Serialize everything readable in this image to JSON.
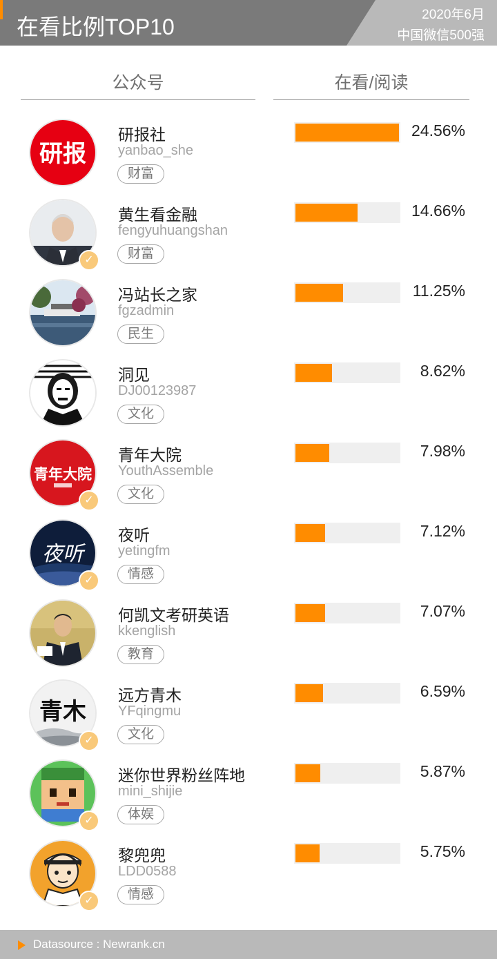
{
  "header": {
    "title": "在看比例TOP10",
    "date": "2020年6月",
    "subtitle": "中国微信500强"
  },
  "columns": {
    "account": "公众号",
    "ratio": "在看/阅读"
  },
  "colors": {
    "accent": "#ff8c00",
    "track": "#efefef",
    "header_bg": "#7a7a7a",
    "ribbon_bg": "#b9b9b9"
  },
  "chart_data": {
    "type": "bar",
    "orientation": "horizontal",
    "value_label": "在看/阅读",
    "unit": "%",
    "categories": [
      "研报社",
      "黄生看金融",
      "冯站长之家",
      "洞见",
      "青年大院",
      "夜听",
      "何凯文考研英语",
      "远方青木",
      "迷你世界粉丝阵地",
      "黎兜兜"
    ],
    "values": [
      24.56,
      14.66,
      11.25,
      8.62,
      7.98,
      7.12,
      7.07,
      6.59,
      5.87,
      5.75
    ],
    "xlim": [
      0,
      24.56
    ],
    "grid": false,
    "legend": "none"
  },
  "rows": [
    {
      "name": "研报社",
      "account": "yanbao_she",
      "tag": "财富",
      "value": 24.56,
      "pct_label": "24.56%",
      "verified": false,
      "avatar_icon": "yanbao-logo-icon",
      "avatar_text": "研报"
    },
    {
      "name": "黄生看金融",
      "account": "fengyuhuangshan",
      "tag": "财富",
      "value": 14.66,
      "pct_label": "14.66%",
      "verified": true,
      "avatar_icon": "man-portrait-icon"
    },
    {
      "name": "冯站长之家",
      "account": "fgzadmin",
      "tag": "民生",
      "value": 11.25,
      "pct_label": "11.25%",
      "verified": false,
      "avatar_icon": "lake-scenery-icon"
    },
    {
      "name": "洞见",
      "account": "DJ00123987",
      "tag": "文化",
      "value": 8.62,
      "pct_label": "8.62%",
      "verified": false,
      "avatar_icon": "woodcut-portrait-icon"
    },
    {
      "name": "青年大院",
      "account": "YouthAssemble",
      "tag": "文化",
      "value": 7.98,
      "pct_label": "7.98%",
      "verified": true,
      "avatar_icon": "youth-logo-icon",
      "avatar_text": "青年大院"
    },
    {
      "name": "夜听",
      "account": "yetingfm",
      "tag": "情感",
      "value": 7.12,
      "pct_label": "7.12%",
      "verified": true,
      "avatar_icon": "night-logo-icon",
      "avatar_text": "夜听"
    },
    {
      "name": "何凯文考研英语",
      "account": "kkenglish",
      "tag": "教育",
      "value": 7.07,
      "pct_label": "7.07%",
      "verified": false,
      "avatar_icon": "speaker-photo-icon"
    },
    {
      "name": "远方青木",
      "account": "YFqingmu",
      "tag": "文化",
      "value": 6.59,
      "pct_label": "6.59%",
      "verified": true,
      "avatar_icon": "calligraphy-icon",
      "avatar_text": "青木"
    },
    {
      "name": "迷你世界粉丝阵地",
      "account": "mini_shijie",
      "tag": "体娱",
      "value": 5.87,
      "pct_label": "5.87%",
      "verified": true,
      "avatar_icon": "game-character-icon"
    },
    {
      "name": "黎兜兜",
      "account": "LDD0588",
      "tag": "情感",
      "value": 5.75,
      "pct_label": "5.75%",
      "verified": true,
      "avatar_icon": "cartoon-boy-icon"
    }
  ],
  "footer": {
    "source": "Datasource : Newrank.cn"
  }
}
